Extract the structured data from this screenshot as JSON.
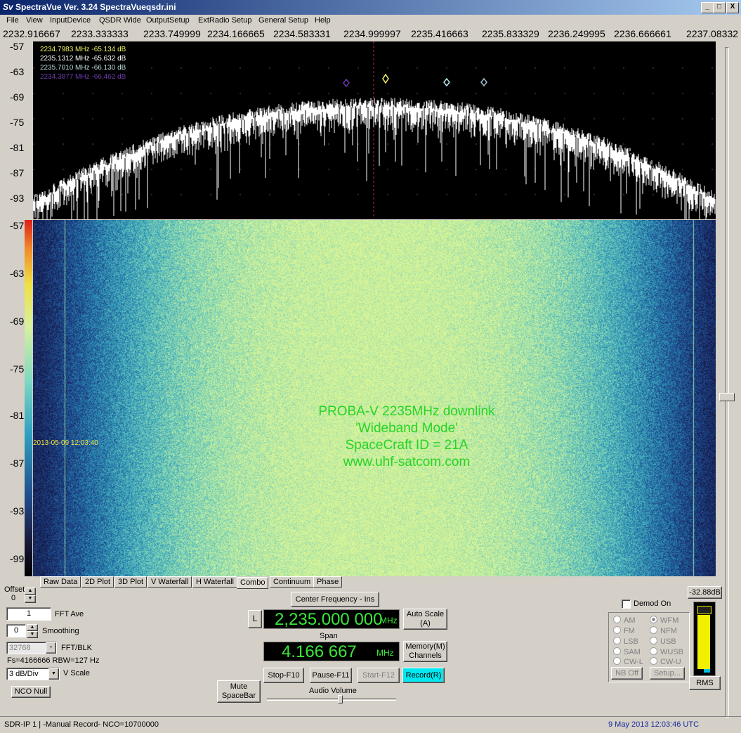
{
  "window": {
    "title": "SpectraVue Ver. 3.24  SpectraVueqsdr.ini",
    "logo": "Sv",
    "minimize": "_",
    "restore": "□",
    "close": "X"
  },
  "menu": [
    "File",
    "View",
    "InputDevice",
    "QSDR Wide",
    "OutputSetup",
    "ExtRadio Setup",
    "General Setup",
    "Help"
  ],
  "freq_axis": [
    "2232.916667",
    "2233.333333",
    "2233.749999",
    "2234.166665",
    "2234.583331",
    "2234.999997",
    "2235.416663",
    "2235.833329",
    "2236.249995",
    "2236.666661",
    "2237.08332"
  ],
  "spectrum_y": [
    "-57",
    "-63",
    "-69",
    "-75",
    "-81",
    "-87",
    "-93"
  ],
  "waterfall_y": [
    "-57",
    "-63",
    "-69",
    "-75",
    "-81",
    "-87",
    "-93",
    "-99"
  ],
  "markers": [
    {
      "text": "2234.7983 MHz  -65.134 dB",
      "color": "#f0f060"
    },
    {
      "text": "2235.1312 MHz  -65.632 dB",
      "color": "#ffffff"
    },
    {
      "text": "2235.7010 MHz  -66.130 dB",
      "color": "#b8d8d8"
    },
    {
      "text": "2234.3877 MHz  -66.462 dB",
      "color": "#6a3aa8"
    }
  ],
  "waterfall_timestamp": "2013-05-09 12:03:40",
  "overlay": {
    "line1": "PROBA-V 2235MHz downlink",
    "line2": "'Wideband Mode'",
    "line3": "SpaceCraft ID = 21A",
    "line4": "www.uhf-satcom.com"
  },
  "tabs": [
    "Raw Data",
    "2D Plot",
    "3D Plot",
    "V Waterfall",
    "H Waterfall",
    "Combo",
    "Continuum",
    "Phase"
  ],
  "active_tab": "Combo",
  "controls": {
    "offset_label": "Offset",
    "offset_value": "0",
    "fft_ave_value": "1",
    "fft_ave_label": "FFT Ave",
    "smoothing_value": "0",
    "smoothing_label": "Smoothing",
    "fft_blk_value": "32768",
    "fft_blk_label": "FFT/BLK",
    "fs_info": "Fs=4166666 RBW=127 Hz",
    "vscale_value": "3 dB/Div",
    "vscale_label": "V Scale",
    "nco_null": "NCO Null",
    "center_freq_button": "Center Frequency - Ins",
    "l_button": "L",
    "center_freq_value": "2,235.000 000",
    "center_freq_unit": "MHz",
    "auto_scale": "Auto Scale (A)",
    "span_label": "Span",
    "span_value": "4.166 667",
    "span_unit": "MHz",
    "memory": "Memory(M) Channels",
    "mute": "Mute SpaceBar",
    "stop": "Stop-F10",
    "pause": "Pause-F11",
    "start": "Start-F12",
    "record": "Record(R)",
    "audio_volume": "Audio Volume",
    "level_db": "-32.88dB",
    "demod_on": "Demod On",
    "rms": "RMS",
    "nb_off": "NB Off",
    "setup": "Setup..."
  },
  "demod_left": [
    "AM",
    "FM",
    "LSB",
    "SAM",
    "CW-L"
  ],
  "demod_right": [
    "WFM",
    "NFM",
    "USB",
    "WUSB",
    "CW-U"
  ],
  "demod_selected": "WFM",
  "status": {
    "left": "SDR-IP 1  | -Manual Record-   NCO=10700000",
    "right": "9 May 2013  12:03:46 UTC"
  },
  "colors": {
    "titlebar": "#0a246a",
    "record_active": "#00e8f0",
    "overlay_text": "#27d427",
    "digits": "#39e839"
  }
}
